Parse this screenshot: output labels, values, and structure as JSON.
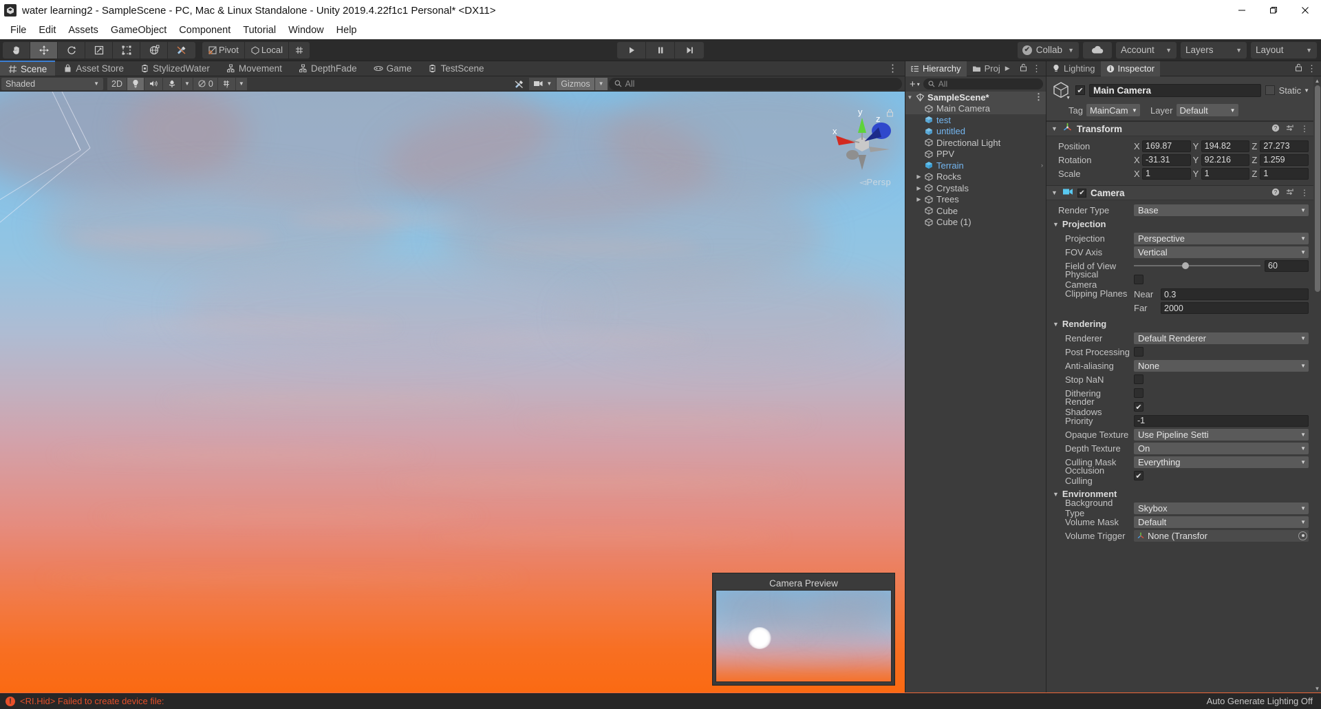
{
  "window": {
    "title": "water learning2 - SampleScene - PC, Mac & Linux Standalone - Unity 2019.4.22f1c1 Personal* <DX11>",
    "minimize": "—",
    "maximize": "❐",
    "close": "✕"
  },
  "menubar": {
    "items": [
      "File",
      "Edit",
      "Assets",
      "GameObject",
      "Component",
      "Tutorial",
      "Window",
      "Help"
    ]
  },
  "toolbar": {
    "transform_tools": [
      {
        "name": "hand-tool",
        "glyph": "✋",
        "active": false
      },
      {
        "name": "move-tool",
        "glyph": "✥",
        "active": true
      },
      {
        "name": "rotate-tool",
        "glyph": "↺",
        "active": false
      },
      {
        "name": "scale-tool",
        "glyph": "⤢",
        "active": false
      },
      {
        "name": "rect-tool",
        "glyph": "⛶",
        "active": false
      },
      {
        "name": "transform-tool",
        "glyph": "✣",
        "active": false
      },
      {
        "name": "custom-editor-tool",
        "glyph": "⚒",
        "active": false
      }
    ],
    "pivot_label": "Pivot",
    "local_label": "Local",
    "grid_snap_label": "⊞",
    "play_label": "▶",
    "pause_label": "❚❚",
    "step_label": "▶❙",
    "collab_label": "Collab",
    "collab_check": "✔",
    "cloud_label": "☁",
    "account_label": "Account",
    "layers_label": "Layers",
    "layout_label": "Layout",
    "caret": "▼"
  },
  "scene": {
    "tabs": [
      {
        "label": "Scene",
        "icon": "grid-icon",
        "active": true
      },
      {
        "label": "Asset Store",
        "icon": "store-icon",
        "active": false
      },
      {
        "label": "StylizedWater",
        "icon": "script-icon",
        "active": false
      },
      {
        "label": "Movement",
        "icon": "node-icon",
        "active": false
      },
      {
        "label": "DepthFade",
        "icon": "node-icon",
        "active": false
      },
      {
        "label": "Game",
        "icon": "gamepad-icon",
        "active": false
      },
      {
        "label": "TestScene",
        "icon": "script-icon",
        "active": false
      }
    ],
    "more_glyph": "⋮",
    "subbar": {
      "shading_mode": "Shaded",
      "two_d_label": "2D",
      "lighting_glyph": "💡",
      "audio_glyph": "🔊",
      "fx_glyph": "✿",
      "hidden_count": "0",
      "grid_glyph": "▦",
      "tools_glyph": "⚒",
      "camera_glyph": "🎥",
      "gizmos_label": "Gizmos",
      "search_placeholder": "All",
      "caret": "▼"
    },
    "gizmo": {
      "x_label": "x",
      "y_label": "y",
      "z_label": "z",
      "persp_label": "Persp",
      "persp_arrow": "◅"
    },
    "camera_preview_title": "Camera Preview"
  },
  "hierarchy": {
    "tabs": [
      {
        "label": "Hierarchy",
        "icon": "hierarchy-icon",
        "active": true
      },
      {
        "label": "Proj",
        "icon": "folder-icon",
        "active": false
      }
    ],
    "tab_arrow": "▶",
    "lock_glyph": "🔒",
    "more_glyph": "⋮",
    "add_label": "+",
    "add_caret": "▾",
    "search_placeholder": "All",
    "items": [
      {
        "label": "SampleScene*",
        "depth": 0,
        "icon": "scene-icon",
        "expanded": true,
        "root": true,
        "selected": false,
        "blue": false,
        "dots": "⋮"
      },
      {
        "label": "Main Camera",
        "depth": 1,
        "icon": "gameobject-icon",
        "expanded": null,
        "root": false,
        "selected": true,
        "blue": false
      },
      {
        "label": "test",
        "depth": 1,
        "icon": "prefab-icon",
        "expanded": null,
        "root": false,
        "selected": false,
        "blue": true
      },
      {
        "label": "untitled",
        "depth": 1,
        "icon": "prefab-icon",
        "expanded": null,
        "root": false,
        "selected": false,
        "blue": true
      },
      {
        "label": "Directional Light",
        "depth": 1,
        "icon": "gameobject-icon",
        "expanded": null,
        "root": false,
        "selected": false,
        "blue": false
      },
      {
        "label": "PPV",
        "depth": 1,
        "icon": "gameobject-icon",
        "expanded": null,
        "root": false,
        "selected": false,
        "blue": false
      },
      {
        "label": "Terrain",
        "depth": 1,
        "icon": "prefab-blue-icon",
        "expanded": null,
        "root": false,
        "selected": false,
        "blue": true,
        "chev": "›"
      },
      {
        "label": "Rocks",
        "depth": 1,
        "icon": "gameobject-icon",
        "expanded": false,
        "root": false,
        "selected": false,
        "blue": false
      },
      {
        "label": "Crystals",
        "depth": 1,
        "icon": "gameobject-icon",
        "expanded": false,
        "root": false,
        "selected": false,
        "blue": false
      },
      {
        "label": "Trees",
        "depth": 1,
        "icon": "gameobject-icon",
        "expanded": false,
        "root": false,
        "selected": false,
        "blue": false
      },
      {
        "label": "Cube",
        "depth": 1,
        "icon": "gameobject-icon",
        "expanded": null,
        "root": false,
        "selected": false,
        "blue": false
      },
      {
        "label": "Cube (1)",
        "depth": 1,
        "icon": "gameobject-icon",
        "expanded": null,
        "root": false,
        "selected": false,
        "blue": false
      }
    ]
  },
  "inspector": {
    "tabs": [
      {
        "label": "Lighting",
        "icon": "lightbulb-icon",
        "active": false
      },
      {
        "label": "Inspector",
        "icon": "info-icon",
        "active": true
      }
    ],
    "lock_glyph": "🔒",
    "more_glyph": "⋮",
    "object": {
      "enabled_check": "✔",
      "name": "Main Camera",
      "static_label": "Static",
      "static_caret": "▼",
      "tag_label": "Tag",
      "tag_value": "MainCam",
      "layer_label": "Layer",
      "layer_value": "Default"
    },
    "transform": {
      "title": "Transform",
      "help_glyph": "?",
      "preset_glyph": "⇥",
      "menu_glyph": "⋮",
      "rows": [
        {
          "label": "Position",
          "x": "169.87",
          "y": "194.82",
          "z": "27.273"
        },
        {
          "label": "Rotation",
          "x": "-31.31",
          "y": "92.216",
          "z": "1.259"
        },
        {
          "label": "Scale",
          "x": "1",
          "y": "1",
          "z": "1"
        }
      ],
      "axis_labels": [
        "X",
        "Y",
        "Z"
      ]
    },
    "camera": {
      "title": "Camera",
      "enabled_check": "✔",
      "render_type_label": "Render Type",
      "render_type_value": "Base",
      "projection_section": "Projection",
      "projection_label": "Projection",
      "projection_value": "Perspective",
      "fov_axis_label": "FOV Axis",
      "fov_axis_value": "Vertical",
      "fov_label": "Field of View",
      "fov_value": "60",
      "fov_percent": 38,
      "physical_camera_label": "Physical Camera",
      "physical_camera_checked": false,
      "clipping_label": "Clipping Planes",
      "near_label": "Near",
      "near_value": "0.3",
      "far_label": "Far",
      "far_value": "2000",
      "rendering_section": "Rendering",
      "renderer_label": "Renderer",
      "renderer_value": "Default Renderer",
      "post_processing_label": "Post Processing",
      "post_processing_checked": false,
      "anti_aliasing_label": "Anti-aliasing",
      "anti_aliasing_value": "None",
      "stop_nan_label": "Stop NaN",
      "stop_nan_checked": false,
      "dithering_label": "Dithering",
      "dithering_checked": false,
      "render_shadows_label": "Render Shadows",
      "render_shadows_checked": true,
      "priority_label": "Priority",
      "priority_value": "-1",
      "opaque_texture_label": "Opaque Texture",
      "opaque_texture_value": "Use Pipeline Setti",
      "depth_texture_label": "Depth Texture",
      "depth_texture_value": "On",
      "culling_mask_label": "Culling Mask",
      "culling_mask_value": "Everything",
      "occlusion_culling_label": "Occlusion Culling",
      "occlusion_culling_checked": true,
      "environment_section": "Environment",
      "background_type_label": "Background Type",
      "background_type_value": "Skybox",
      "volume_mask_label": "Volume Mask",
      "volume_mask_value": "Default",
      "volume_trigger_label": "Volume Trigger",
      "volume_trigger_value": "None (Transfor",
      "check_glyph": "✔",
      "caret": "▼"
    }
  },
  "statusbar": {
    "error_badge": "!",
    "error_message": "<RI.Hid> Failed to create device file:",
    "right_text": "Auto Generate Lighting Off"
  },
  "colors": {
    "accent_blue": "#3b7fd4",
    "error_red": "#e4502a",
    "panel_bg": "#383838",
    "prefab_blue": "#74b6f0"
  }
}
